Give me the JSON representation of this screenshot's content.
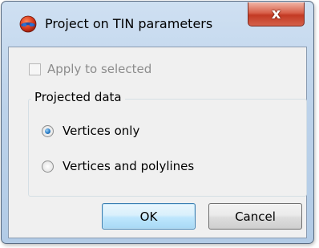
{
  "window": {
    "title": "Project on TIN parameters",
    "close_label": "x"
  },
  "apply_to_selected": {
    "label": "Apply to selected",
    "checked": false,
    "enabled": false
  },
  "projected_data": {
    "title": "Projected data",
    "options": [
      {
        "label": "Vertices only",
        "selected": true
      },
      {
        "label": "Vertices and polylines",
        "selected": false
      }
    ]
  },
  "buttons": {
    "ok_label": "OK",
    "cancel_label": "Cancel"
  },
  "colors": {
    "close_button": "#c33a24",
    "default_button_border": "#3c7fb1",
    "radio_selected": "#2a7cc7",
    "disabled_text": "#8c8c8c"
  },
  "icons": {
    "app": "tin-globe-icon",
    "close": "close-icon"
  }
}
